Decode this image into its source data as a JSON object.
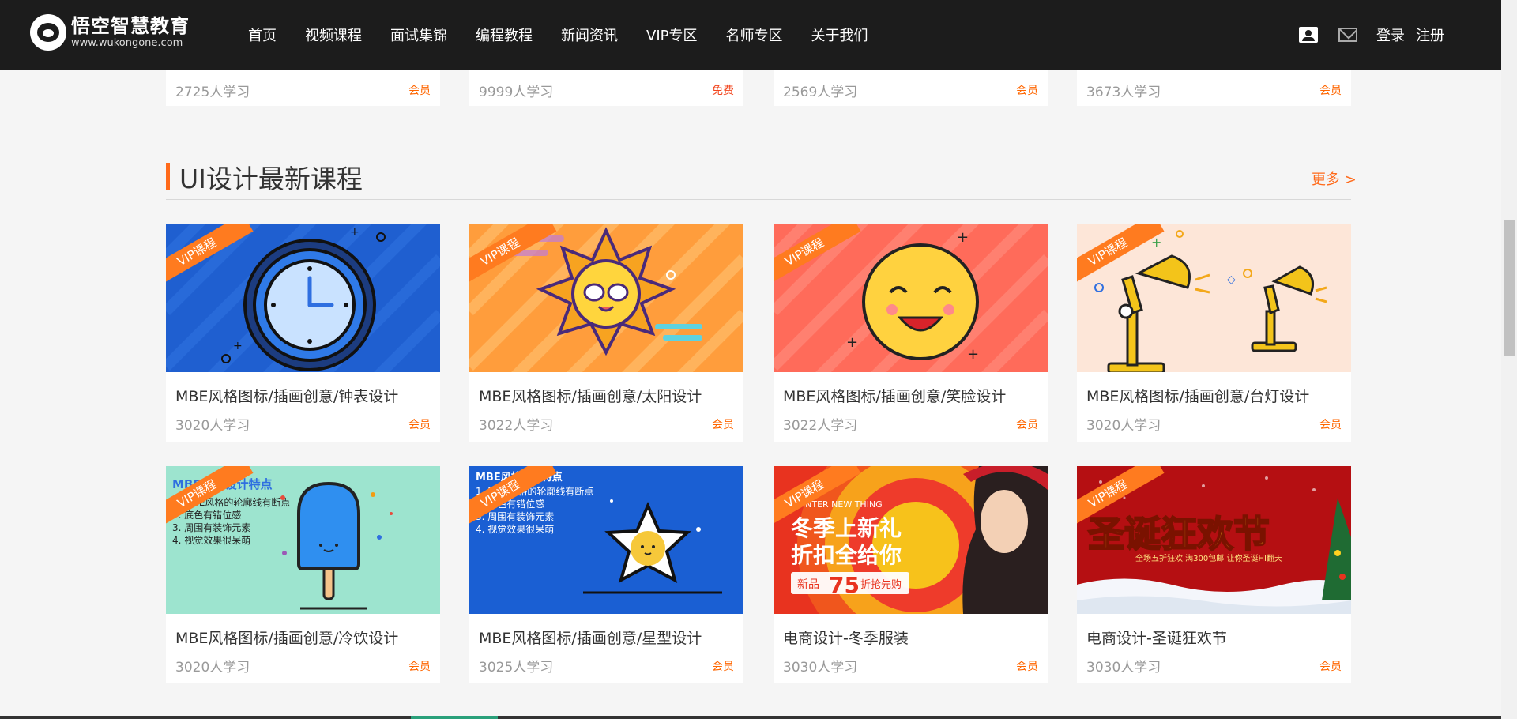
{
  "header": {
    "logo_name": "悟空智慧教育",
    "logo_url": "www.wukongone.com",
    "nav": [
      "首页",
      "视频课程",
      "面试集锦",
      "编程教程",
      "新闻资讯",
      "VIP专区",
      "名师专区",
      "关于我们"
    ],
    "login": "登录",
    "register": "注册"
  },
  "top_row": [
    {
      "learners": "2725人学习",
      "tag": "会员"
    },
    {
      "learners": "9999人学习",
      "tag": "免费"
    },
    {
      "learners": "2569人学习",
      "tag": "会员"
    },
    {
      "learners": "3673人学习",
      "tag": "会员"
    }
  ],
  "section": {
    "title": "UI设计最新课程",
    "more": "更多 >"
  },
  "ribbon": "VIP课程",
  "courses": [
    {
      "title": "MBE风格图标/插画创意/钟表设计",
      "learners": "3020人学习",
      "tag": "会员"
    },
    {
      "title": "MBE风格图标/插画创意/太阳设计",
      "learners": "3022人学习",
      "tag": "会员"
    },
    {
      "title": "MBE风格图标/插画创意/笑脸设计",
      "learners": "3022人学习",
      "tag": "会员"
    },
    {
      "title": "MBE风格图标/插画创意/台灯设计",
      "learners": "3020人学习",
      "tag": "会员"
    },
    {
      "title": "MBE风格图标/插画创意/冷饮设计",
      "learners": "3020人学习",
      "tag": "会员"
    },
    {
      "title": "MBE风格图标/插画创意/星型设计",
      "learners": "3025人学习",
      "tag": "会员"
    },
    {
      "title": "电商设计-冬季服装",
      "learners": "3030人学习",
      "tag": "会员"
    },
    {
      "title": "电商设计-圣诞狂欢节",
      "learners": "3030人学习",
      "tag": "会员"
    }
  ],
  "thumb_text": {
    "mbe_heading": "MBE风格设计特点",
    "mbe_points": [
      "1. MBE风格的轮廓线有断点",
      "2. 底色有错位感",
      "3. 周围有装饰元素",
      "4. 视觉效果很呆萌"
    ],
    "winter_en": "WINTER NEW THING",
    "winter_line1": "冬季上新礼",
    "winter_line2": "折扣全给你",
    "winter_new": "新品",
    "winter_num": "75",
    "winter_discount": "折抢先购",
    "xmas_title": "圣诞狂欢节",
    "xmas_sub": "全场五折狂欢    满300包邮    让你圣诞HI翻天"
  },
  "colors": {
    "header_bg": "#1c1c1c",
    "accent": "#ff6a1a",
    "tag": "#ff6600"
  }
}
